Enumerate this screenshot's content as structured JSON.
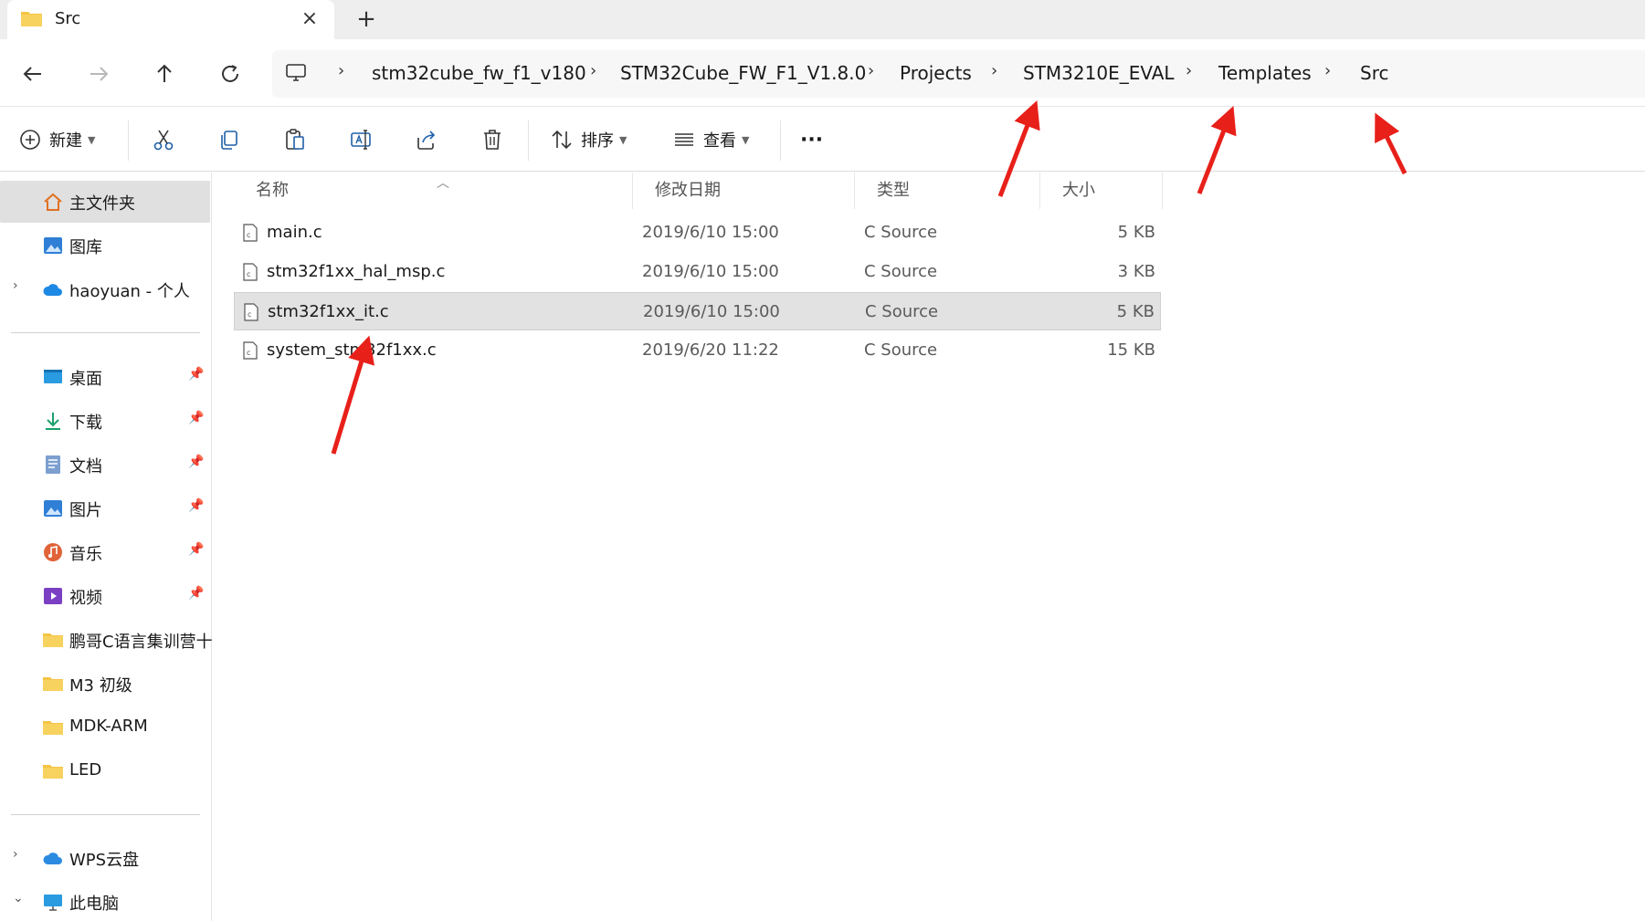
{
  "tab": {
    "title": "Src",
    "close_glyph": "×",
    "add_glyph": "+"
  },
  "nav": {
    "back_icon": "back-arrow-icon",
    "forward_icon": "forward-arrow-icon",
    "up_icon": "up-arrow-icon",
    "refresh_icon": "refresh-icon",
    "breadcrumbs": [
      "stm32cube_fw_f1_v180",
      "STM32Cube_FW_F1_V1.8.0",
      "Projects",
      "STM3210E_EVAL",
      "Templates",
      "Src"
    ],
    "separator": "›"
  },
  "toolbar": {
    "new_label": "新建",
    "sort_label": "排序",
    "view_label": "查看",
    "more_label": "···"
  },
  "sidebar": {
    "home": "主文件夹",
    "gallery": "图库",
    "cloud": "haoyuan - 个人",
    "pinned": [
      {
        "label": "桌面",
        "icon": "desktop-icon"
      },
      {
        "label": "下载",
        "icon": "download-icon"
      },
      {
        "label": "文档",
        "icon": "documents-icon"
      },
      {
        "label": "图片",
        "icon": "pictures-icon"
      },
      {
        "label": "音乐",
        "icon": "music-icon"
      },
      {
        "label": "视频",
        "icon": "video-icon"
      }
    ],
    "folders": [
      "鹏哥C语言集训营十",
      "M3 初级",
      "MDK-ARM",
      "LED"
    ],
    "wps": "WPS云盘",
    "thispc": "此电脑"
  },
  "columns": {
    "name": "名称",
    "date": "修改日期",
    "type": "类型",
    "size": "大小"
  },
  "files": [
    {
      "name": "main.c",
      "date": "2019/6/10 15:00",
      "type": "C Source",
      "size": "5 KB"
    },
    {
      "name": "stm32f1xx_hal_msp.c",
      "date": "2019/6/10 15:00",
      "type": "C Source",
      "size": "3 KB"
    },
    {
      "name": "stm32f1xx_it.c",
      "date": "2019/6/10 15:00",
      "type": "C Source",
      "size": "5 KB"
    },
    {
      "name": "system_stm32f1xx.c",
      "date": "2019/6/20 11:22",
      "type": "C Source",
      "size": "15 KB"
    }
  ],
  "colors": {
    "accent": "#0067c0",
    "folder": "#f4c443",
    "annotation": "#e8201a",
    "selected_row": "#e2e2e2"
  }
}
